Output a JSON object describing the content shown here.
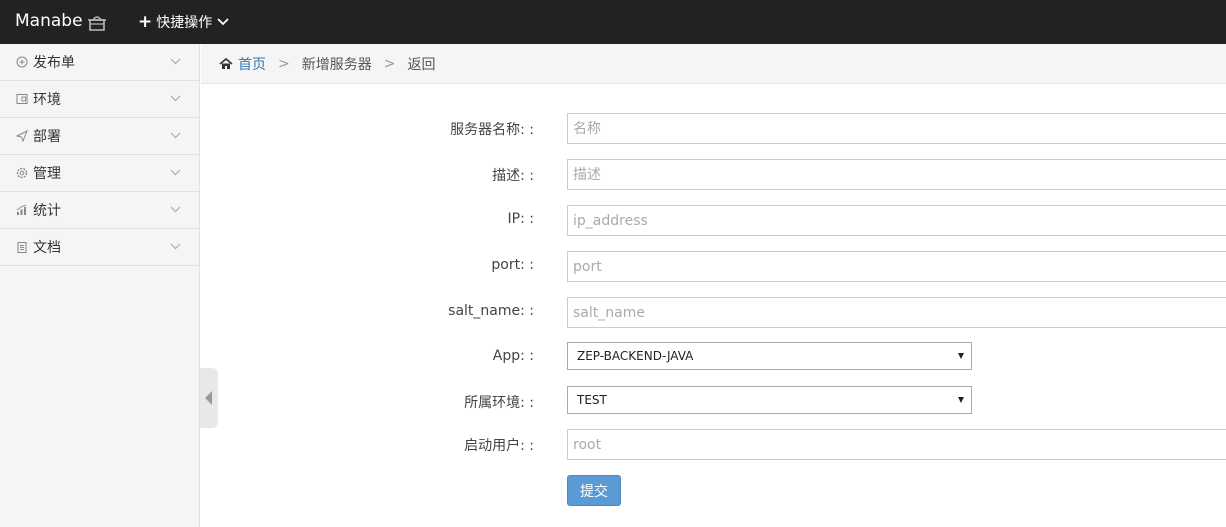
{
  "header": {
    "brand": "Manabe",
    "quick_actions": "快捷操作"
  },
  "sidebar": {
    "items": [
      {
        "label": "发布单",
        "icon": "plus-circle-icon"
      },
      {
        "label": "环境",
        "icon": "window-icon"
      },
      {
        "label": "部署",
        "icon": "send-icon"
      },
      {
        "label": "管理",
        "icon": "gear-icon"
      },
      {
        "label": "统计",
        "icon": "bar-chart-icon"
      },
      {
        "label": "文档",
        "icon": "clipboard-icon"
      }
    ]
  },
  "breadcrumb": {
    "home": "首页",
    "current": "新增服务器",
    "back": "返回",
    "separator": ">"
  },
  "form": {
    "name": {
      "label": "服务器名称: :",
      "placeholder": "名称"
    },
    "description": {
      "label": "描述: :",
      "placeholder": "描述"
    },
    "ip": {
      "label": "IP: :",
      "placeholder": "ip_address"
    },
    "port": {
      "label": "port: :",
      "placeholder": "port"
    },
    "salt_name": {
      "label": "salt_name: :",
      "placeholder": "salt_name"
    },
    "app": {
      "label": "App: :",
      "value": "ZEP-BACKEND-JAVA"
    },
    "env": {
      "label": "所属环境: :",
      "value": "TEST"
    },
    "user": {
      "label": "启动用户: :",
      "placeholder": "root"
    },
    "submit": "提交"
  },
  "colors": {
    "topbar": "#222222",
    "link": "#337ab7",
    "submit": "#5b9bd5"
  }
}
